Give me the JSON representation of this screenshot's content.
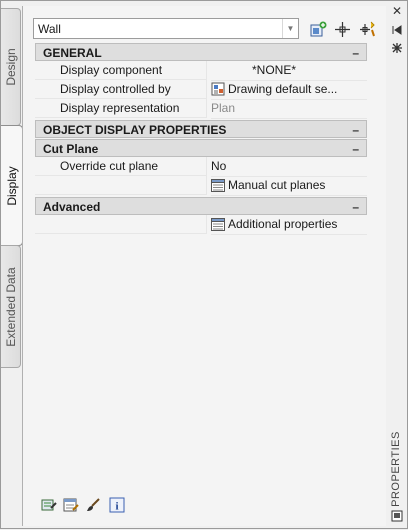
{
  "tabs": [
    {
      "label": "Design",
      "active": false
    },
    {
      "label": "Display",
      "active": true
    },
    {
      "label": "Extended Data",
      "active": false
    }
  ],
  "style_selector": {
    "value": "Wall"
  },
  "toolbar": {
    "icons": [
      "add-style-icon",
      "pick-object-icon",
      "quick-select-icon"
    ]
  },
  "categories": {
    "general": {
      "label": "GENERAL",
      "toggle": "–"
    },
    "object_display": {
      "label": "OBJECT DISPLAY PROPERTIES",
      "toggle": "–"
    },
    "cut_plane": {
      "label": "Cut Plane",
      "toggle": "–"
    },
    "advanced": {
      "label": "Advanced",
      "toggle": "–"
    }
  },
  "properties": {
    "display_component": {
      "label": "Display component",
      "value": "*NONE*"
    },
    "display_controlled_by": {
      "label": "Display controlled by",
      "value": "Drawing default se..."
    },
    "display_representation": {
      "label": "Display representation",
      "value": "Plan"
    },
    "override_cut_plane": {
      "label": "Override cut plane",
      "value": "No"
    },
    "manual_cut_planes": {
      "value": "Manual cut planes"
    },
    "additional_properties": {
      "value": "Additional properties"
    }
  },
  "palette": {
    "title": "PROPERTIES",
    "strip_icons": [
      "close-icon",
      "auto-hide-icon",
      "palette-properties-icon",
      "palette-menu-icon"
    ]
  },
  "bottom_icons": [
    "edit-style-icon",
    "style-display-icon",
    "paintbrush-icon",
    "info-icon"
  ]
}
